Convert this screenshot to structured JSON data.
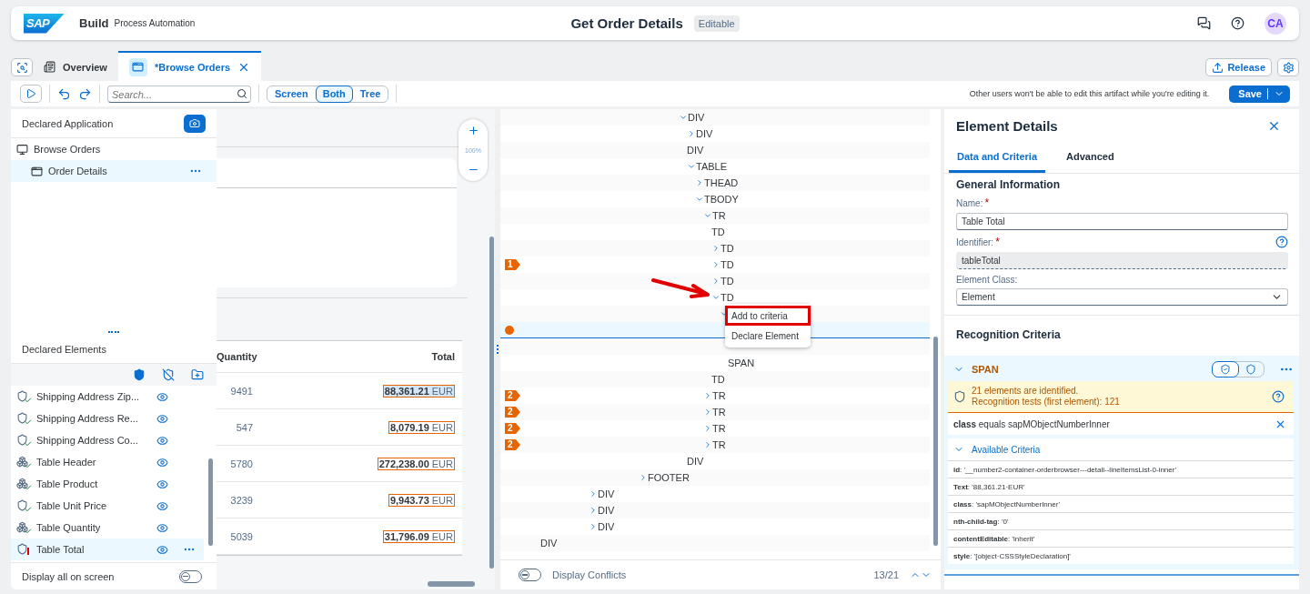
{
  "header": {
    "logo": "SAP",
    "product": "Build",
    "subtitle": "Process Automation",
    "title": "Get Order Details",
    "badge": "Editable",
    "avatar": "CA"
  },
  "tabs": [
    {
      "label": "Overview",
      "selected": false
    },
    {
      "label": "*Browse Orders",
      "selected": true
    }
  ],
  "release_button": "Release",
  "toolbar": {
    "search": {
      "placeholder": "Search..."
    },
    "views": [
      {
        "label": "Screen",
        "selected": false
      },
      {
        "label": "Both",
        "selected": true
      },
      {
        "label": "Tree",
        "selected": false
      }
    ],
    "message": "Other users won't be able to edit this artifact while you're editing it.",
    "save": "Save"
  },
  "declared_application": {
    "title": "Declared Application",
    "items": [
      {
        "label": "Browse Orders",
        "kind": "application",
        "selected": false,
        "children": [
          {
            "label": "Order Details",
            "kind": "screen",
            "selected": true
          }
        ]
      }
    ]
  },
  "declared_elements": {
    "title": "Declared Elements",
    "filters": [
      {
        "kind": "declared",
        "selected": true
      },
      {
        "kind": "undeclared",
        "selected": false
      },
      {
        "kind": "folder",
        "selected": false
      }
    ],
    "items": [
      {
        "label": "Shipping Address Zip...",
        "kind": "single",
        "valid": true,
        "selected": false
      },
      {
        "label": "Shipping Address Re...",
        "kind": "single",
        "valid": true,
        "selected": false
      },
      {
        "label": "Shipping Address Co...",
        "kind": "single",
        "valid": true,
        "selected": false
      },
      {
        "label": "Table Header",
        "kind": "list",
        "valid": true,
        "selected": false
      },
      {
        "label": "Table Product",
        "kind": "list",
        "valid": true,
        "selected": false
      },
      {
        "label": "Table Unit Price",
        "kind": "single",
        "valid": true,
        "selected": false
      },
      {
        "label": "Table Quantity",
        "kind": "list",
        "valid": true,
        "selected": false
      },
      {
        "label": "Table Total",
        "kind": "single",
        "valid": false,
        "selected": true
      }
    ],
    "display_all": {
      "label": "Display all on screen",
      "on": false
    }
  },
  "preview": {
    "zoom": "100%",
    "columns": [
      "Quantity",
      "Total"
    ],
    "rows": [
      {
        "quantity": "9491",
        "total": "88,361.21",
        "currency": "EUR",
        "selected": true
      },
      {
        "quantity": "547",
        "total": "8,079.19",
        "currency": "EUR",
        "selected": false
      },
      {
        "quantity": "5780",
        "total": "272,238.00",
        "currency": "EUR",
        "selected": false
      },
      {
        "quantity": "3239",
        "total": "9,943.73",
        "currency": "EUR",
        "selected": false
      },
      {
        "quantity": "5039",
        "total": "31,796.09",
        "currency": "EUR",
        "selected": false
      }
    ]
  },
  "tree": {
    "rows": [
      {
        "label": "DIV",
        "expanded": true,
        "selected": false,
        "children": [
          {
            "label": "DIV",
            "expanded": false,
            "selected": false
          },
          {
            "label": "DIV",
            "selected": false
          },
          {
            "label": "TABLE",
            "expanded": true,
            "selected": false,
            "children": [
              {
                "label": "THEAD",
                "expanded": false,
                "selected": false
              },
              {
                "label": "TBODY",
                "expanded": true,
                "selected": false,
                "children": [
                  {
                    "label": "TR",
                    "expanded": true,
                    "selected": false,
                    "children": [
                      {
                        "label": "TD",
                        "selected": false
                      },
                      {
                        "label": "TD",
                        "expanded": false,
                        "selected": false
                      },
                      {
                        "label": "TD",
                        "expanded": false,
                        "selected": false,
                        "badge": "1"
                      },
                      {
                        "label": "TD",
                        "expanded": false,
                        "selected": false
                      },
                      {
                        "label": "TD",
                        "expanded": true,
                        "selected": false,
                        "children": [
                          {
                            "expanded": true,
                            "selected": false,
                            "children": [
                              {
                                "selected": true
                              },
                              {
                                "selected": false
                              },
                              {
                                "label": "SPAN",
                                "selected": false
                              }
                            ]
                          }
                        ]
                      },
                      {
                        "label": "TD",
                        "selected": false
                      }
                    ]
                  },
                  {
                    "label": "TR",
                    "expanded": false,
                    "selected": false,
                    "badge": "2"
                  },
                  {
                    "label": "TR",
                    "expanded": false,
                    "selected": false,
                    "badge": "2"
                  },
                  {
                    "label": "TR",
                    "expanded": false,
                    "selected": false,
                    "badge": "2"
                  },
                  {
                    "label": "TR",
                    "expanded": false,
                    "selected": false,
                    "badge": "2"
                  }
                ]
              }
            ]
          },
          {
            "label": "DIV",
            "selected": false
          }
        ]
      },
      {
        "label": "FOOTER",
        "expanded": false,
        "selected": false
      },
      {
        "label": "DIV",
        "expanded": false,
        "selected": false
      },
      {
        "label": "DIV",
        "expanded": false,
        "selected": false
      },
      {
        "label": "DIV",
        "expanded": false,
        "selected": false
      },
      {
        "label": "DIV",
        "selected": false
      }
    ],
    "menu": [
      {
        "label": "Add to criteria",
        "highlighted": true
      },
      {
        "label": "Declare Element",
        "highlighted": false
      }
    ],
    "conflicts": {
      "label": "Display Conflicts",
      "on": false
    },
    "counter": "13/21"
  },
  "details": {
    "title": "Element Details",
    "tabs": [
      {
        "label": "Data and Criteria",
        "selected": true
      },
      {
        "label": "Advanced",
        "selected": false
      }
    ],
    "general": {
      "title": "General Information",
      "fields": [
        {
          "label": "Name:",
          "required_mark": "*",
          "value": "Table Total",
          "kind": "input"
        },
        {
          "label": "Identifier:",
          "required_mark": "*",
          "value": "tableTotal",
          "kind": "readonly"
        },
        {
          "label": "Element Class:",
          "value": "Element",
          "kind": "select"
        }
      ]
    },
    "recognition": {
      "title": "Recognition Criteria",
      "tag": "SPAN",
      "expanded": true,
      "message": [
        "21 elements are identified.",
        "Recognition tests (first element): 121"
      ],
      "criteria": [
        "**class** equals sapMObjectNumberInner"
      ],
      "available": {
        "title": "Available Criteria",
        "expanded": true,
        "items": [
          "**id**: '__number2-container-orderbrowser---detail--lineItemsList-0-inner'",
          "**Text**: '88,361.21·EUR'",
          "**class**: 'sapMObjectNumberInner'",
          "**nth-child-tag**: '0'",
          "**contentEditable**: 'inherit'",
          "**style**: '[object·CSSStyleDeclaration]'"
        ]
      }
    }
  }
}
